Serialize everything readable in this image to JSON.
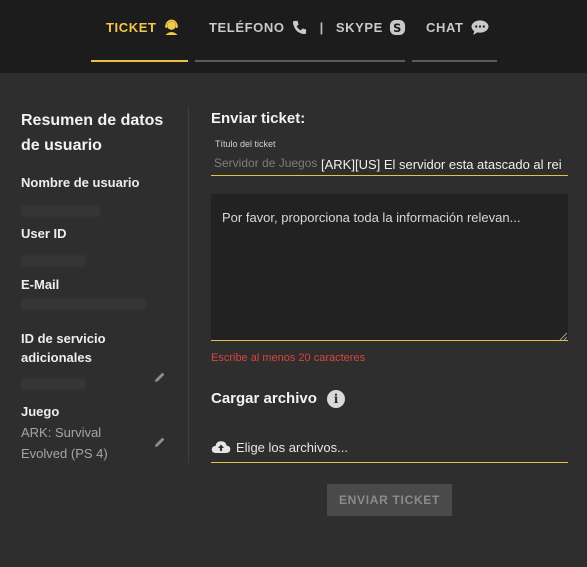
{
  "tabs": [
    {
      "label": "TICKET",
      "icon": "support-agent-icon",
      "active": true
    },
    {
      "label": "TELÉFONO",
      "icon": "phone-icon",
      "active": false
    },
    {
      "label": "SKYPE",
      "icon": "skype-icon",
      "active": false
    },
    {
      "label": "CHAT",
      "icon": "chat-bubble-icon",
      "active": false
    }
  ],
  "tab_separator": "|",
  "sidebar": {
    "title": "Resumen de datos de usuario",
    "fields": [
      {
        "label": "Nombre de usuario",
        "value": ""
      },
      {
        "label": "User ID",
        "value": ""
      },
      {
        "label": "E-Mail",
        "value": ""
      },
      {
        "label": "ID de servicio adicionales",
        "value": ""
      },
      {
        "label": "Juego",
        "value": "ARK: Survival Evolved (PS 4)"
      }
    ]
  },
  "form": {
    "title": "Enviar ticket:",
    "subject_label": "Título del ticket",
    "subject_prefix": "Servidor de Juegos",
    "subject_value": "[ARK][US] El servidor esta atascado al rei",
    "message_placeholder": "Por favor, proporciona toda la información relevan...",
    "error": "Escribe al menos 20 caracteres",
    "upload_title": "Cargar archivo",
    "upload_info_icon": "info-icon",
    "file_label": "Elige los archivos...",
    "submit_label": "ENVIAR TICKET"
  },
  "colors": {
    "accent": "#e9c04a",
    "error": "#d9453d",
    "panel": "#2e2e2e",
    "topbar": "#1c1c1c"
  }
}
